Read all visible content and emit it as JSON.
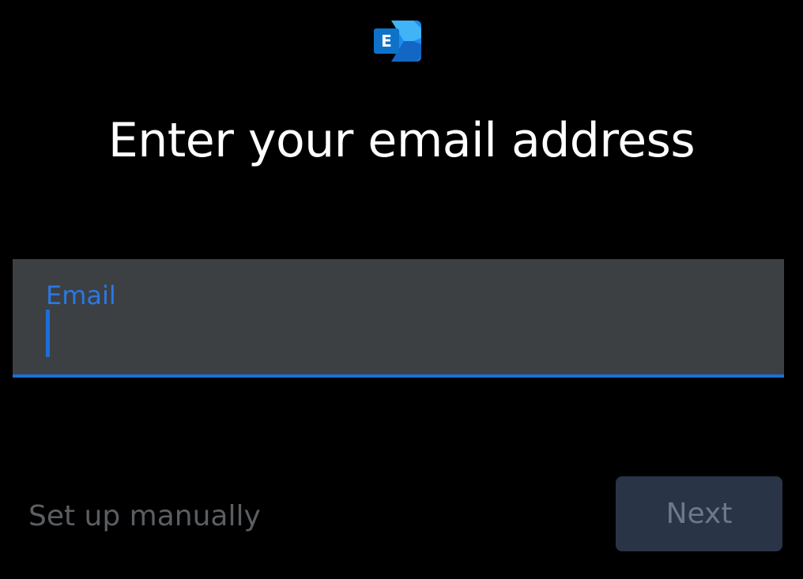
{
  "app": {
    "logo_icon": "exchange-logo-icon",
    "logo_letter": "E",
    "colors": {
      "background": "#000000",
      "accent": "#1d6ed8",
      "field_background": "#3c4043",
      "button_background": "#2a3447",
      "disabled_text": "#5b5e62"
    }
  },
  "header": {
    "title": "Enter your email address"
  },
  "email_field": {
    "label": "Email",
    "value": ""
  },
  "footer": {
    "manual_setup_label": "Set up manually",
    "next_label": "Next"
  }
}
